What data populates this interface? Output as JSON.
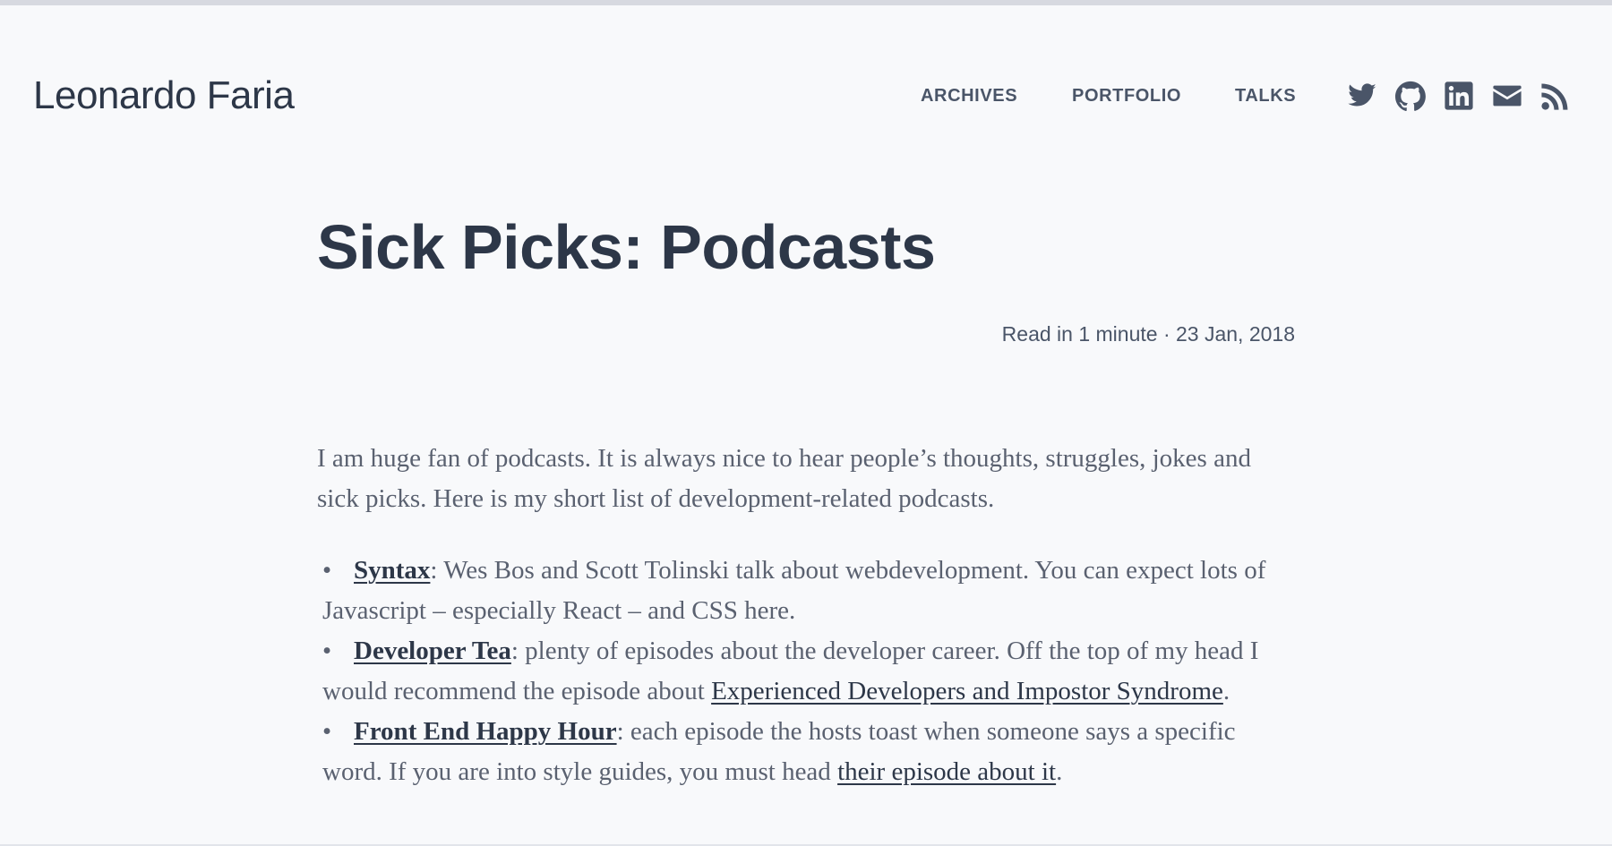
{
  "site": {
    "title": "Leonardo Faria"
  },
  "nav": {
    "items": [
      {
        "label": "ARCHIVES"
      },
      {
        "label": "PORTFOLIO"
      },
      {
        "label": "TALKS"
      }
    ]
  },
  "social": {
    "icons": [
      "twitter-icon",
      "github-icon",
      "linkedin-icon",
      "email-icon",
      "rss-icon"
    ],
    "color": "#4a5568"
  },
  "post": {
    "title": "Sick Picks: Podcasts",
    "meta": "Read in 1 minute · 23 Jan, 2018",
    "intro": "I am huge fan of podcasts. It is always nice to hear people’s thoughts, struggles, jokes and sick picks. Here is my short list of development-related podcasts.",
    "items": [
      {
        "bullet": "•",
        "name": "Syntax",
        "text": ": Wes Bos and Scott Tolinski talk about webdevelopment. You can expect lots of Javascript – especially React – and CSS here."
      },
      {
        "bullet": "•",
        "name": "Developer Tea",
        "text_before": ": plenty of episodes about the developer career. Off the top of my head I would recommend the episode about ",
        "link": "Experienced Developers and Impostor Syndrome",
        "text_after": "."
      },
      {
        "bullet": "•",
        "name": "Front End Happy Hour",
        "text_before": ": each episode the hosts toast when someone says a specific word. If you are into style guides, you must head ",
        "link": "their episode about it",
        "text_after": "."
      }
    ]
  },
  "colors": {
    "background": "#f8f9fb",
    "heading": "#2d3748",
    "body_text": "#5a6170",
    "nav_text": "#4a5568",
    "top_bar": "#d7d9e0"
  }
}
